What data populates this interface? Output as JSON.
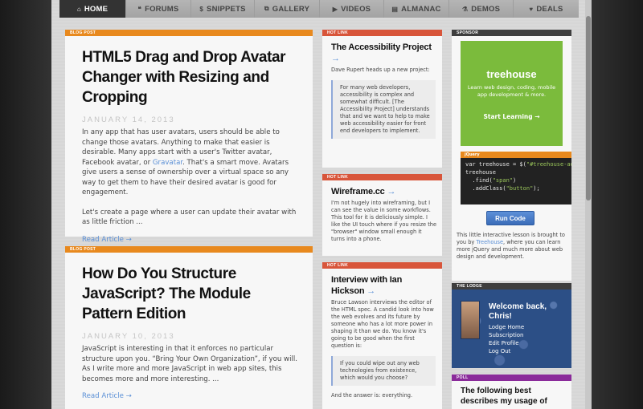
{
  "nav": [
    {
      "icon": "home-icon",
      "glyph": "⌂",
      "label": "Home",
      "active": true
    },
    {
      "icon": "forums-icon",
      "glyph": "❝",
      "label": "Forums"
    },
    {
      "icon": "snippets-icon",
      "glyph": "$",
      "label": "Snippets"
    },
    {
      "icon": "gallery-icon",
      "glyph": "⧉",
      "label": "Gallery"
    },
    {
      "icon": "videos-icon",
      "glyph": "▶",
      "label": "Videos"
    },
    {
      "icon": "almanac-icon",
      "glyph": "▤",
      "label": "Almanac"
    },
    {
      "icon": "demos-icon",
      "glyph": "⚗",
      "label": "Demos"
    },
    {
      "icon": "deals-icon",
      "glyph": "♥",
      "label": "Deals"
    }
  ],
  "posts": [
    {
      "label": "Blog Post",
      "title": "HTML5 Drag and Drop Avatar Changer with Resizing and Cropping",
      "date": "January 14, 2013",
      "p1_a": "In any app that has user avatars, users should be able to change those avatars. Anything to make that easier is desirable. Many apps start with a user's Twitter avatar, Facebook avatar, or ",
      "p1_link": "Gravatar",
      "p1_b": ". That's a smart move. Avatars give users a sense of ownership over a virtual space so any way to get them to have their desired avatar is good for engagement.",
      "p2": "Let's create a page where a user can update their avatar with as little friction ...",
      "read_more": "Read Article →"
    },
    {
      "label": "Blog Post",
      "title": "How Do You Structure JavaScript? The Module Pattern Edition",
      "date": "January 10, 2013",
      "p1": "JavaScript is interesting in that it enforces no particular structure upon you. “Bring Your Own Organization”, if you will. As I write more and more JavaScript in web app sites, this becomes more and more interesting. ...",
      "read_more": "Read Article →"
    }
  ],
  "hotlinks": [
    {
      "label": "Hot Link",
      "title": "The Accessibility Project",
      "arrow": "→",
      "text": "Dave Rupert heads up a new project:",
      "quote": "For many web developers, accessibility is complex and somewhat difficult. [The Accessibility Project] understands that and we want to help to make web accessibility easier for front end developers to implement."
    },
    {
      "label": "Hot Link",
      "title": "Wireframe.cc",
      "arrow": "→",
      "text": "I'm not hugely into wireframing, but I can see the value in some workflows. This tool for it is deliciously simple. I like the UI touch where if you resize the \"browser\" window small enough it turns into a phone."
    },
    {
      "label": "Hot Link",
      "title": "Interview with Ian Hickson",
      "arrow": "→",
      "text": "Bruce Lawson interviews the editor of the HTML spec. A candid look into how the web evolves and its future by someone who has a lot more power in shaping it than we do. You know it's going to be good when the first question is:",
      "quote": "If you could wipe out any web technologies from existence, which would you choose?",
      "tail": "And the answer is: everything."
    }
  ],
  "sponsor": {
    "label": "Sponsor",
    "brand": "treehouse",
    "tagline": "Learn web design, coding, mobile app development & more.",
    "cta": "Start Learning →",
    "code_head": "jQuery",
    "code_line1a": "var treehouse = $(",
    "code_line1s": "\"#treehouse-ad\"",
    "code_line2": "treehouse",
    "code_line3a": "  .find(",
    "code_line3s": "\"span\"",
    "code_line3b": ")",
    "code_line4a": "  .addClass(",
    "code_line4s": "\"button\"",
    "code_line4b": ");",
    "run": "Run Code",
    "text_a": "This little interactive lesson is brought to you by ",
    "text_link": "Treehouse",
    "text_b": ", where you can learn more jQuery and much more about web design and development."
  },
  "lodge": {
    "label": "The Lodge",
    "welcome": "Welcome back, Chris!",
    "links": [
      "Lodge Home",
      "Subscription",
      "Edit Profile",
      "Log Out"
    ]
  },
  "poll": {
    "label": "Poll",
    "title": "The following best describes my usage of"
  },
  "colors": {
    "nav_active": "#333333",
    "blog_label": "#e8891e",
    "hot_label": "#d8553a",
    "link": "#5a8fd6",
    "treehouse": "#7bbb3c",
    "poll": "#8a2a9a"
  }
}
